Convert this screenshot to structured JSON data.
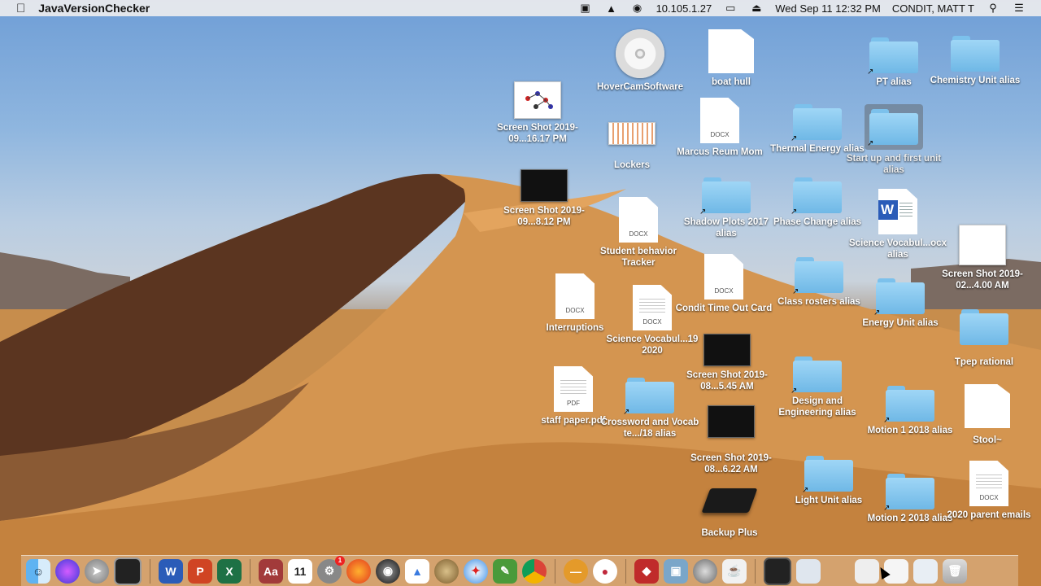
{
  "menubar": {
    "app_name": "JavaVersionChecker",
    "ip": "10.105.1.27",
    "datetime": "Wed Sep 11  12:32 PM",
    "user": "CONDIT, MATT T"
  },
  "desktop": {
    "hovercam": "HoverCamSoftware",
    "boat_hull": "boat hull",
    "pt_alias": "PT alias",
    "chemistry": "Chemistry Unit alias",
    "shot_1617": "Screen Shot 2019-09...16.17 PM",
    "lockers": "Lockers",
    "marcus": "Marcus Reum Mom",
    "thermal": "Thermal Energy alias",
    "startup": "Start up and first unit alias",
    "shot_812": "Screen Shot 2019-09...8.12 PM",
    "student_behavior": "Student behavior Tracker",
    "shadow_plots": "Shadow Plots 2017 alias",
    "phase_change": "Phase Change alias",
    "science_vocab_ocx": "Science Vocabul...ocx alias",
    "shot_400": "Screen Shot 2019-02...4.00 AM",
    "interruptions": "Interruptions",
    "science_vocab_2020": "Science Vocabul...19 2020",
    "condit_timeout": "Condit Time Out Card",
    "class_rosters": "Class rosters alias",
    "energy_unit": "Energy Unit alias",
    "tpep": "Tpep rational",
    "shot_545": "Screen Shot 2019-08...5.45 AM",
    "staff_paper": "staff paper.pdf",
    "crossword": "Crossword and Vocab te.../18 alias",
    "design_eng": "Design and Engineering alias",
    "motion1": "Motion 1 2018 alias",
    "stool": "Stool~",
    "shot_622": "Screen Shot 2019-08...6.22 AM",
    "light_unit": "Light Unit alias",
    "motion2": "Motion 2 2018 alias",
    "parent_emails": "2020 parent emails",
    "backup_plus": "Backup Plus",
    "ext_docx": "DOCX",
    "ext_pdf": "PDF",
    "word_letter": "W"
  },
  "dock": {
    "word": "W",
    "powerpoint": "P",
    "excel": "X",
    "dictionary": "Aa",
    "calendar": "11",
    "badge": "1"
  },
  "colors": {
    "folder": "#8ccdf2",
    "word_blue": "#2b5cb8",
    "menubar": "#ececee"
  }
}
